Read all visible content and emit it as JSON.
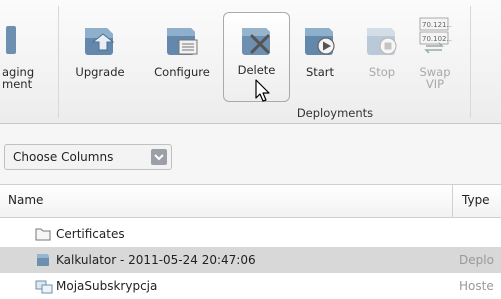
{
  "ribbon": {
    "partial_left_label_line1": "aging",
    "partial_left_label_line2": "ment",
    "buttons": [
      {
        "label": "Upgrade",
        "disabled": false
      },
      {
        "label": "Configure",
        "disabled": false
      },
      {
        "label": "Delete",
        "disabled": false
      },
      {
        "label": "Start",
        "disabled": false
      },
      {
        "label": "Stop",
        "disabled": true
      },
      {
        "label_line1": "Swap",
        "label_line2": "VIP",
        "disabled": true
      }
    ],
    "group_label": "Deployments",
    "swap_badge_line1": "70.121...",
    "swap_badge_line2": "70.102..."
  },
  "toolbar": {
    "choose_columns_label": "Choose Columns"
  },
  "table": {
    "columns": [
      "Name",
      "Type"
    ],
    "rows": [
      {
        "icon": "folder-icon",
        "name": "Certificates",
        "type": "",
        "selected": false
      },
      {
        "icon": "deployment-icon",
        "name": "Kalkulator - 2011-05-24 20:47:06",
        "type": "Deplo",
        "selected": true
      },
      {
        "icon": "hosted-service-icon",
        "name": "MojaSubskrypcja",
        "type": "Hoste",
        "selected": false
      }
    ]
  },
  "colors": {
    "ribbon_bg": "#f1f1f1",
    "selected_row": "#d8d8d8",
    "icon_blue": "#5b84a8",
    "disabled_text": "#a8a8a8"
  }
}
